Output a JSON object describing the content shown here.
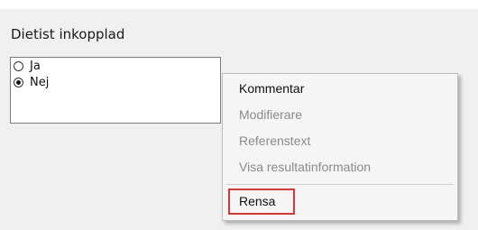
{
  "section": {
    "title": "Dietist inkopplad"
  },
  "options": [
    {
      "label": "Ja",
      "checked": false
    },
    {
      "label": "Nej",
      "checked": true
    }
  ],
  "context_menu": {
    "items": [
      {
        "label": "Kommentar",
        "enabled": true
      },
      {
        "label": "Modifierare",
        "enabled": false
      },
      {
        "label": "Referenstext",
        "enabled": false
      },
      {
        "label": "Visa resultatinformation",
        "enabled": false
      },
      {
        "label": "Rensa",
        "enabled": true,
        "highlighted": true
      }
    ],
    "highlight_color": "#d23a3a"
  }
}
